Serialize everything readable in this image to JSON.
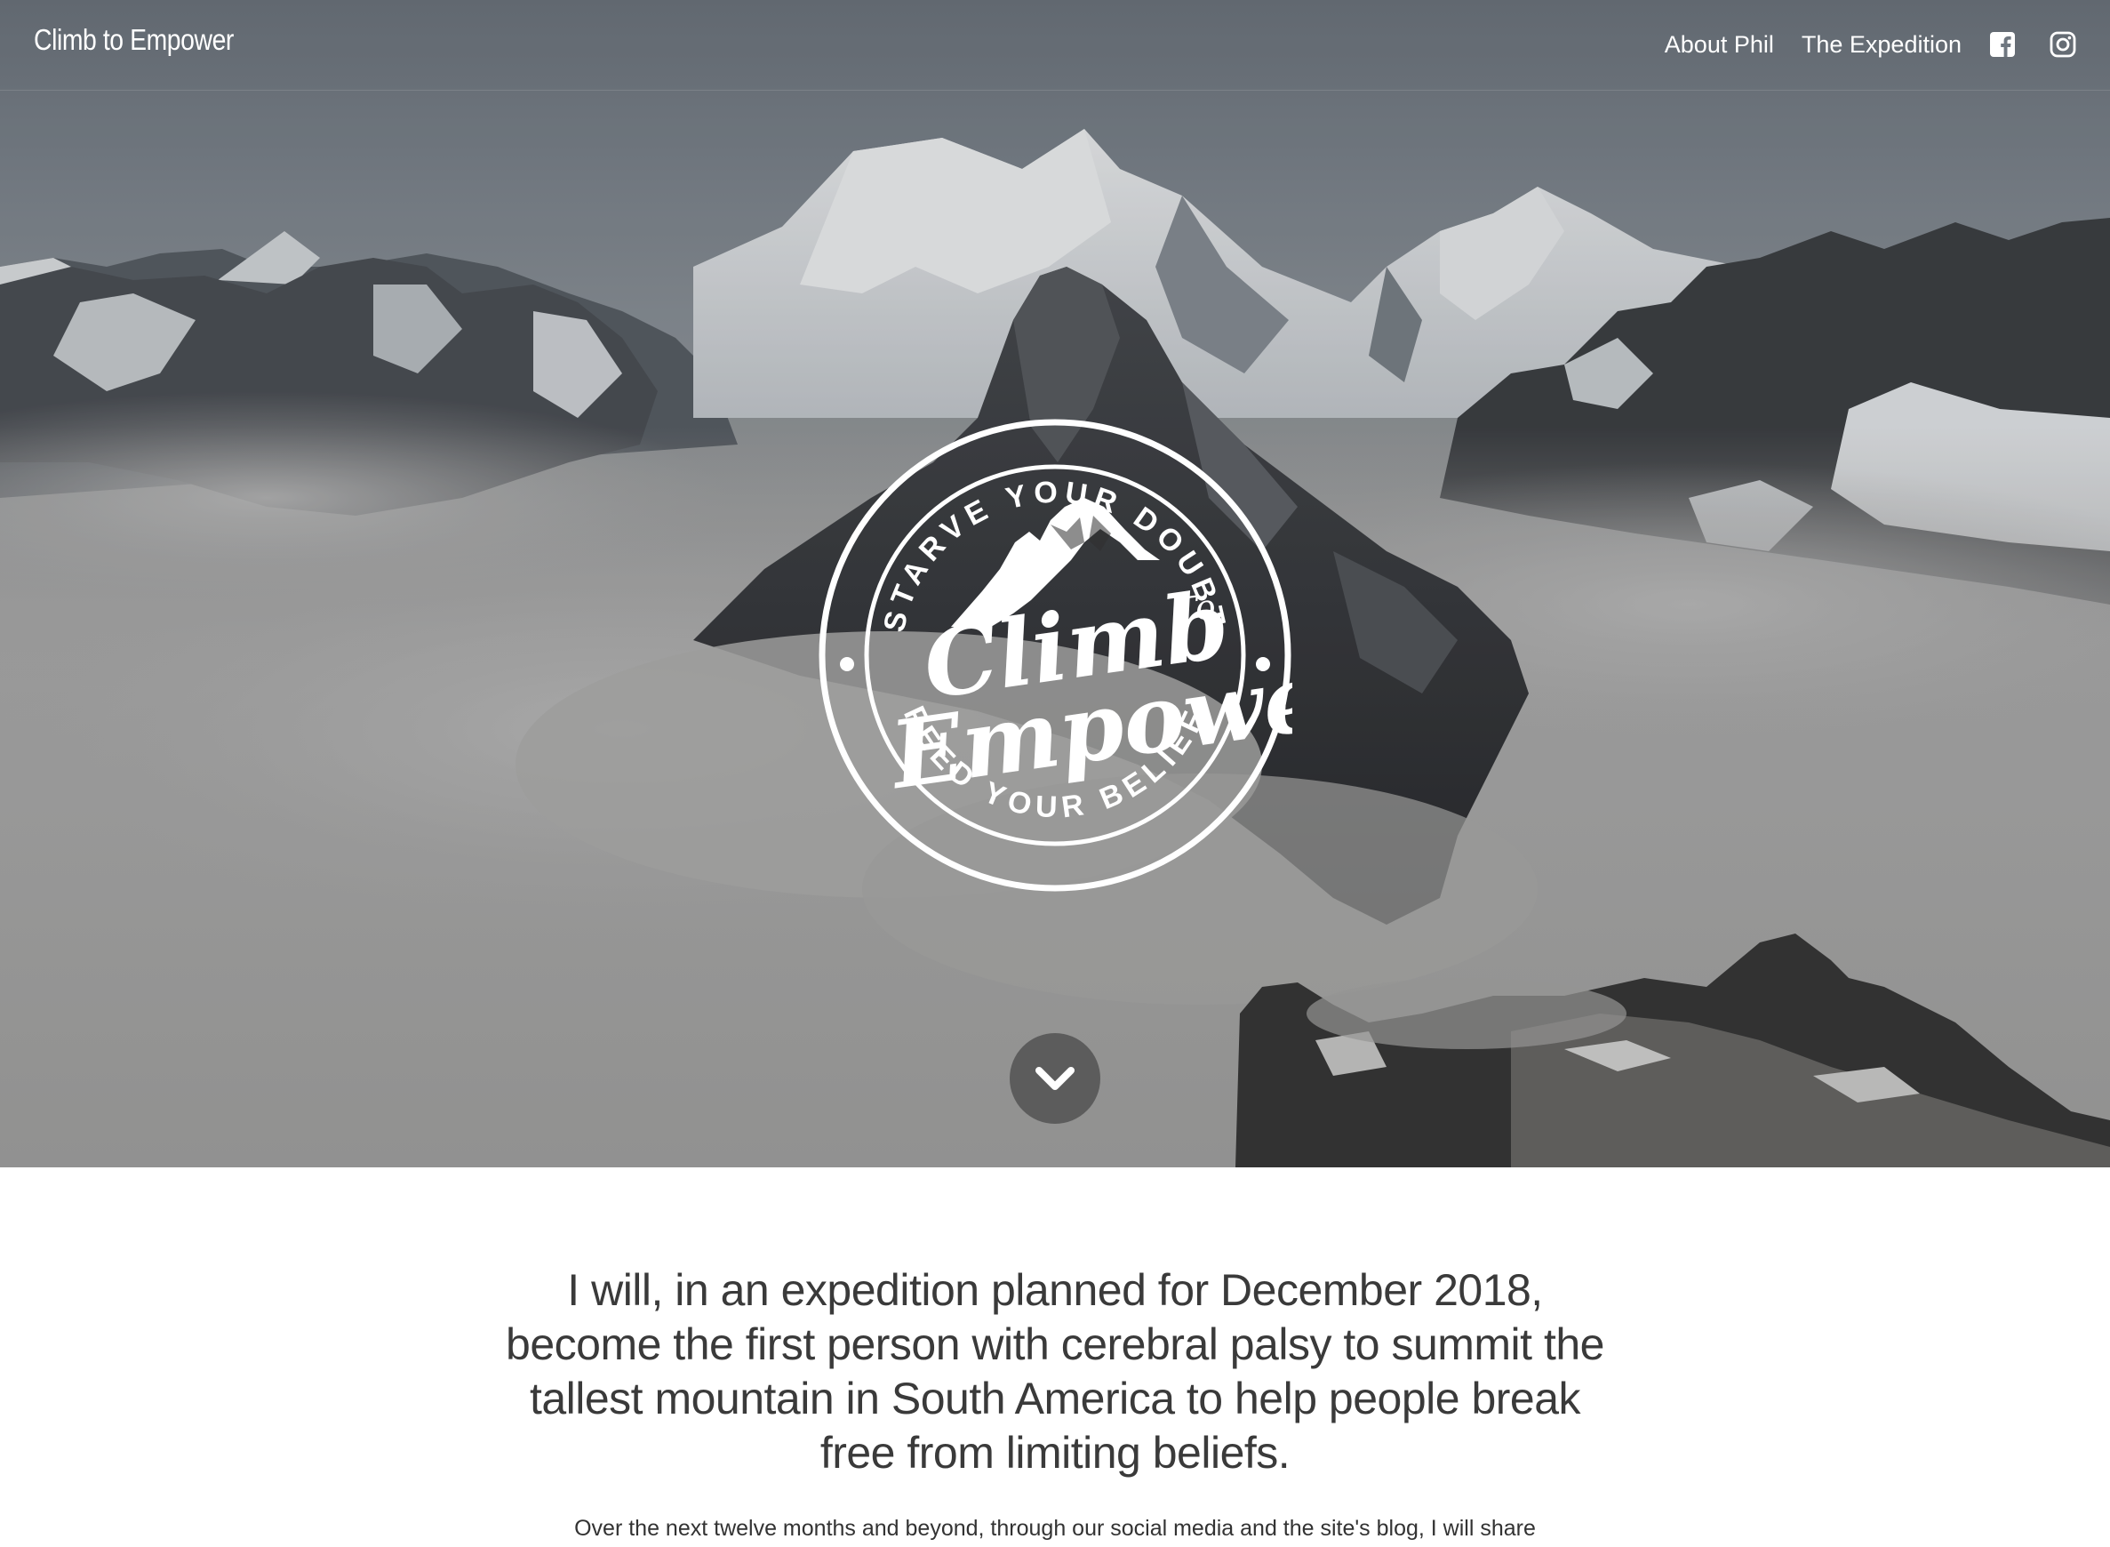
{
  "navbar": {
    "brand": "Climb to Empower",
    "links": [
      {
        "label": "About Phil"
      },
      {
        "label": "The Expedition"
      }
    ],
    "social": [
      {
        "icon": "facebook-icon"
      },
      {
        "icon": "instagram-icon"
      }
    ]
  },
  "hero": {
    "badge": {
      "top_text": "STARVE YOUR DOUBT",
      "bottom_text": "FEED YOUR BELIEF",
      "script_line1": "Climb",
      "script_to": "To",
      "script_line2": "Empower"
    },
    "scroll_icon": "chevron-down-icon"
  },
  "content": {
    "mission": "I will, in an expedition planned for December 2018, become the first person with cerebral palsy to summit the tallest mountain in South America to help people break free from limiting beliefs.",
    "intro": "Over the next twelve months and beyond, through our social media and the site's blog, I will share"
  },
  "colors": {
    "nav_text": "#ffffff",
    "body_text": "#333333",
    "scroll_button": "#505050"
  }
}
